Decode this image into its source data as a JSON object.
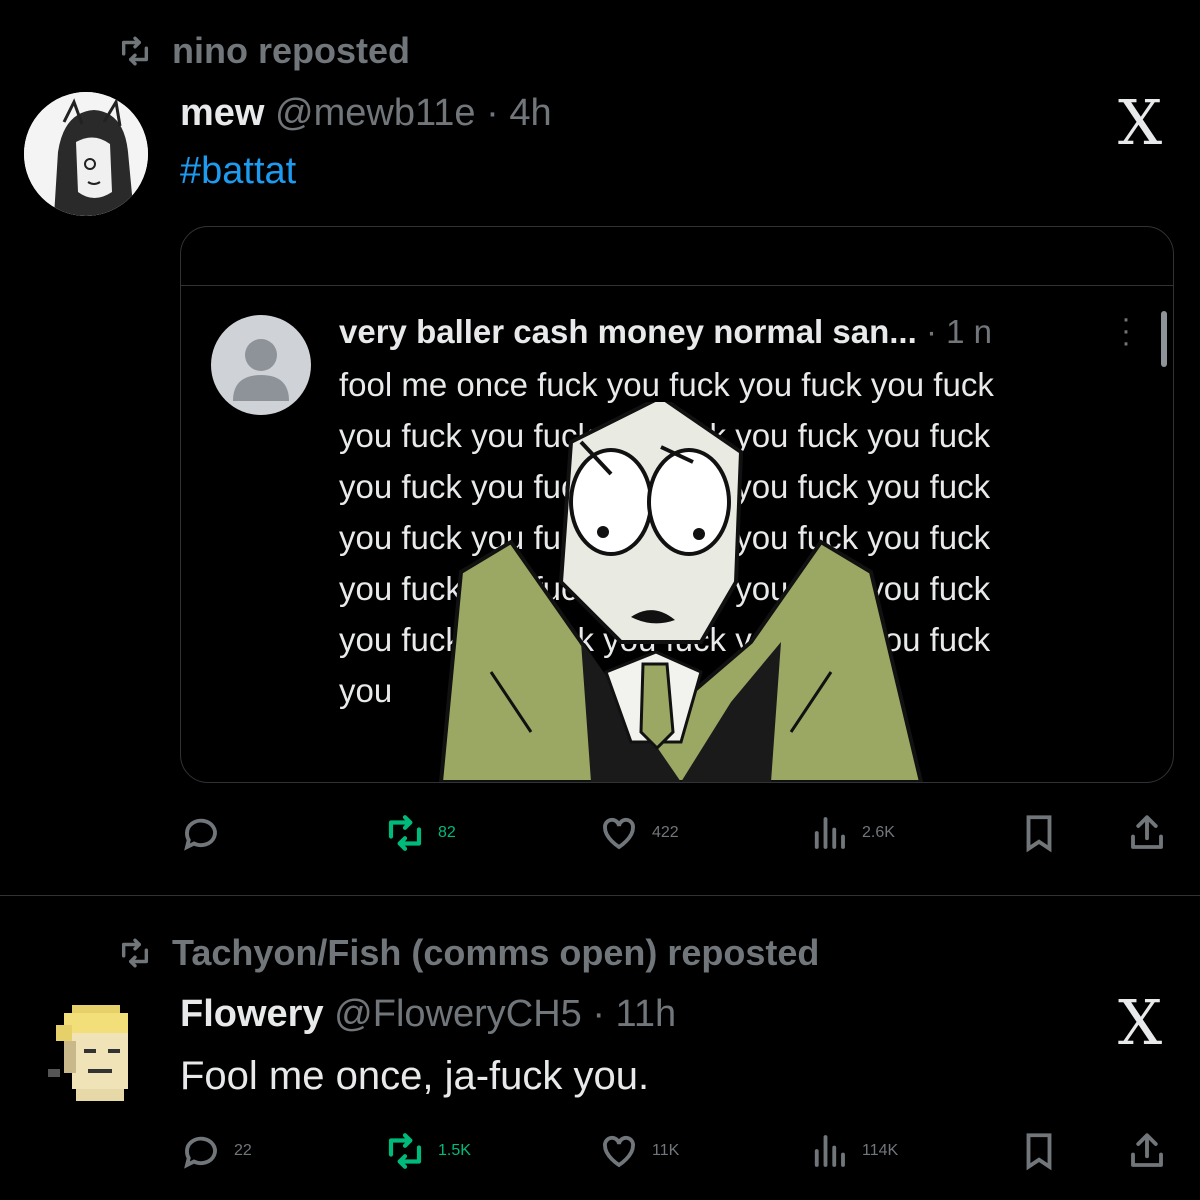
{
  "posts": [
    {
      "reposted_by": "nino reposted",
      "display_name": "mew",
      "handle_time": "@mewb11e · 4h",
      "text": "#battat",
      "embedded": {
        "title": "very baller cash money normal san...",
        "time": "· 1 n",
        "lines": [
          "fool me once fuck you fuck you fuck you fuck",
          "you fuck you fuck you fuck you fuck you fuck",
          "you fuck you fuck you fuck you fuck you fuck",
          "you fuck you fuck you fuck you fuck you fuck",
          "you fuck you fuck you fuck you fuck you fuck",
          "you fuck you fuck you fuck you fuck you fuck",
          "you"
        ]
      },
      "stats": {
        "replies": "",
        "reposts": "82",
        "likes": "422",
        "views": "2.6K"
      }
    },
    {
      "reposted_by": "Tachyon/Fish (comms open) reposted",
      "display_name": "Flowery",
      "handle_time": "@FloweryCH5 · 11h",
      "text": "Fool me once, ja-fuck you.",
      "stats": {
        "replies": "22",
        "reposts": "1.5K",
        "likes": "11K",
        "views": "114K"
      }
    }
  ],
  "brand_icon": "X",
  "colors": {
    "background": "#000000",
    "text": "#e7e9ea",
    "muted": "#71767b",
    "link": "#1d9bf0",
    "repost_green": "#00ba7c",
    "border": "#2f3336"
  },
  "icons": [
    "repost-icon",
    "reply-icon",
    "like-icon",
    "views-icon",
    "bookmark-icon",
    "share-icon",
    "x-logo-icon",
    "more-icon"
  ]
}
